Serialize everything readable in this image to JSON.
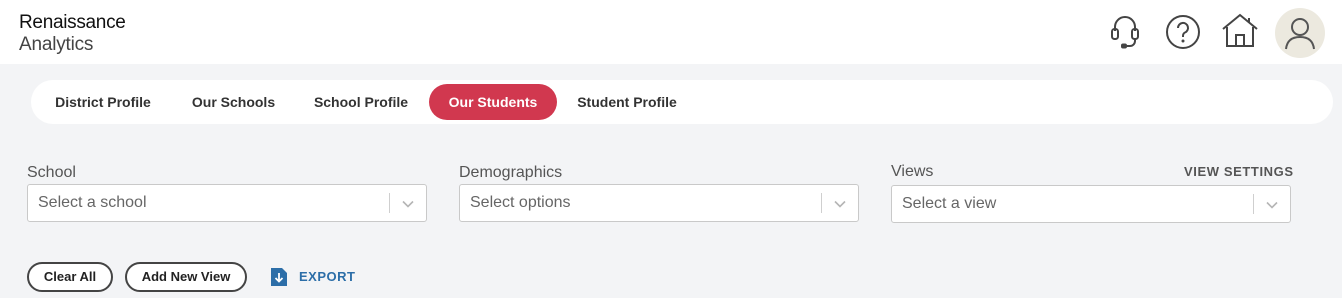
{
  "brand": {
    "line1": "Renaissance",
    "line2": "Analytics"
  },
  "header_icons": [
    "headset-icon",
    "help-icon",
    "home-icon",
    "user-icon"
  ],
  "tabs": [
    {
      "label": "District Profile",
      "active": false
    },
    {
      "label": "Our Schools",
      "active": false
    },
    {
      "label": "School Profile",
      "active": false
    },
    {
      "label": "Our Students",
      "active": true
    },
    {
      "label": "Student Profile",
      "active": false
    }
  ],
  "filters": {
    "school": {
      "label": "School",
      "placeholder": "Select a school"
    },
    "demographics": {
      "label": "Demographics",
      "placeholder": "Select options"
    },
    "views": {
      "label": "Views",
      "placeholder": "Select a view",
      "settings_label": "VIEW SETTINGS"
    }
  },
  "actions": {
    "clear_all": "Clear All",
    "add_new_view": "Add New View",
    "export": "EXPORT"
  },
  "colors": {
    "accent": "#d1384f",
    "link": "#2c6ea8",
    "page_bg": "#f3f4f6",
    "avatar_bg": "#ece9df"
  }
}
